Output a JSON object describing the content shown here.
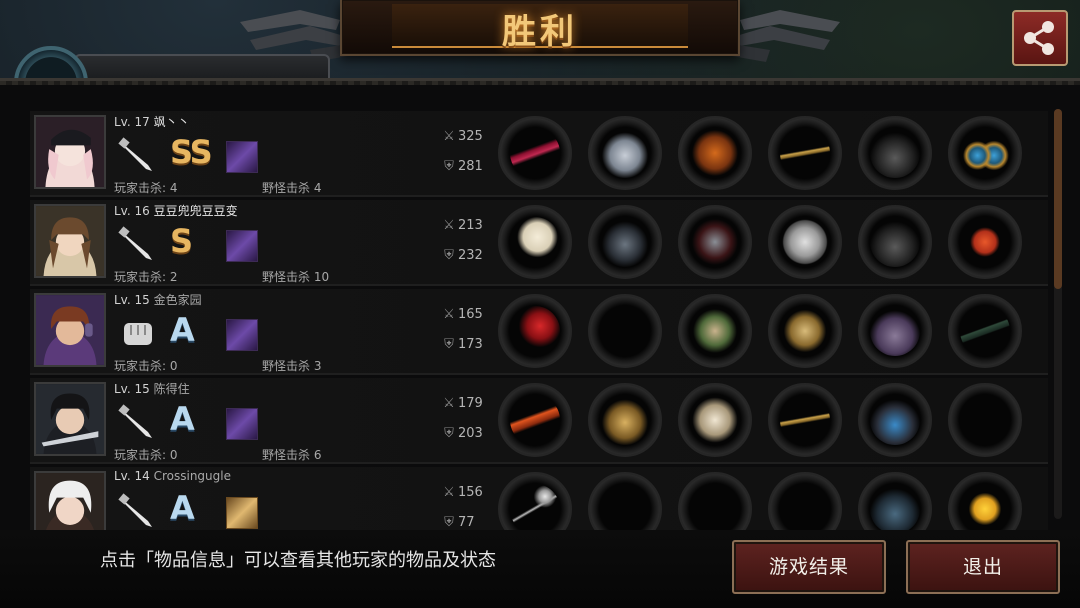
{
  "title": "胜利",
  "hidden_tab_label": "",
  "share_icon": "share-icon",
  "players": [
    {
      "level": "Lv. 17",
      "name": "飒丶丶",
      "rank": "SS",
      "weapon": "knife",
      "skill": "purple-skill",
      "player_kills_label": "玩家击杀: 4",
      "monster_kills_label": "野怪击杀 4",
      "attack": "325",
      "defense": "281",
      "items": [
        "crimson-blade",
        "steel-helmet",
        "flame-armor",
        "golden-vine-belt",
        "black-boots",
        "blue-earrings"
      ]
    },
    {
      "level": "Lv. 16",
      "name": "豆豆兜兜豆豆变",
      "rank": "S",
      "weapon": "knife",
      "skill": "purple-skill",
      "player_kills_label": "玩家击杀: 2",
      "monster_kills_label": "野怪击杀 10",
      "attack": "213",
      "defense": "232",
      "items": [
        "white-flag-staff",
        "dark-helmet",
        "crimson-gauntlet",
        "silver-disc",
        "black-boots",
        "red-dice"
      ]
    },
    {
      "level": "Lv. 15",
      "name": "金色家园",
      "rank": "A",
      "weapon": "fist",
      "skill": "purple-skill",
      "player_kills_label": "玩家击杀: 0",
      "monster_kills_label": "野怪击杀 3",
      "attack": "165",
      "defense": "173",
      "items": [
        "red-claw",
        "",
        "green-armor",
        "gold-shield",
        "purple-boots",
        "sniper-scope"
      ]
    },
    {
      "level": "Lv. 15",
      "name": "陈得住",
      "rank": "A",
      "weapon": "knife",
      "skill": "purple-skill",
      "player_kills_label": "玩家击杀: 0",
      "monster_kills_label": "野怪击杀 6",
      "attack": "179",
      "defense": "203",
      "items": [
        "flame-sword",
        "golden-helmet",
        "white-armor",
        "golden-vine-belt",
        "blue-sneakers",
        ""
      ]
    },
    {
      "level": "Lv. 14",
      "name": "Crossingugle",
      "rank": "A",
      "weapon": "knife",
      "skill": "gold-skill",
      "player_kills_label": "",
      "monster_kills_label": "",
      "attack": "156",
      "defense": "77",
      "items": [
        "scythe",
        "",
        "",
        "",
        "dark-boots",
        "yellow-flower"
      ]
    }
  ],
  "footer": {
    "hint": "点击「物品信息」可以查看其他玩家的物品及状态",
    "result_button": "游戏结果",
    "exit_button": "退出"
  },
  "colors": {
    "accent": "#e7b661",
    "button": "#5e2320",
    "title_glow": "#d8892b"
  }
}
